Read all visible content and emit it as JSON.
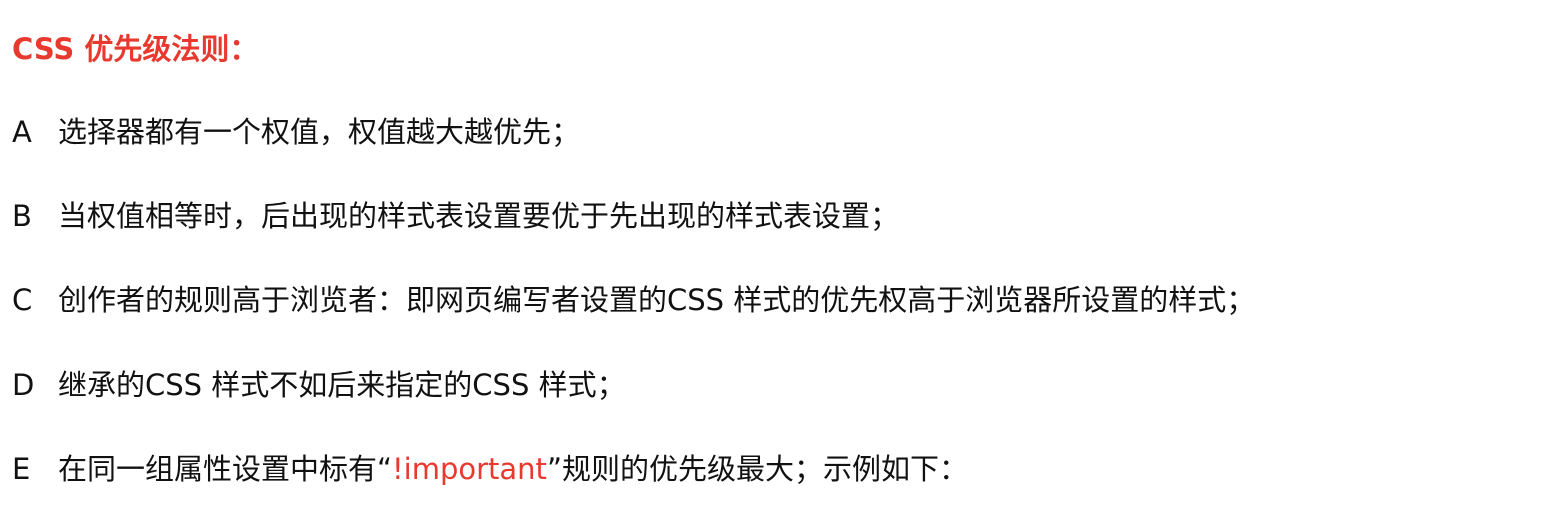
{
  "colors": {
    "accent": "#e8392f",
    "text": "#111111",
    "background": "#ffffff"
  },
  "title": "CSS 优先级法则：",
  "rules": [
    {
      "letter": "A",
      "text": "选择器都有一个权值，权值越大越优先；"
    },
    {
      "letter": "B",
      "text": "当权值相等时，后出现的样式表设置要优于先出现的样式表设置；"
    },
    {
      "letter": "C",
      "text": "创作者的规则高于浏览者：即网页编写者设置的CSS 样式的优先权高于浏览器所设置的样式；"
    },
    {
      "letter": "D",
      "text": "继承的CSS 样式不如后来指定的CSS 样式；"
    },
    {
      "letter": "E",
      "text_before": "在同一组属性设置中标有“",
      "highlight": "!important",
      "text_after": "”规则的优先级最大；示例如下："
    }
  ]
}
